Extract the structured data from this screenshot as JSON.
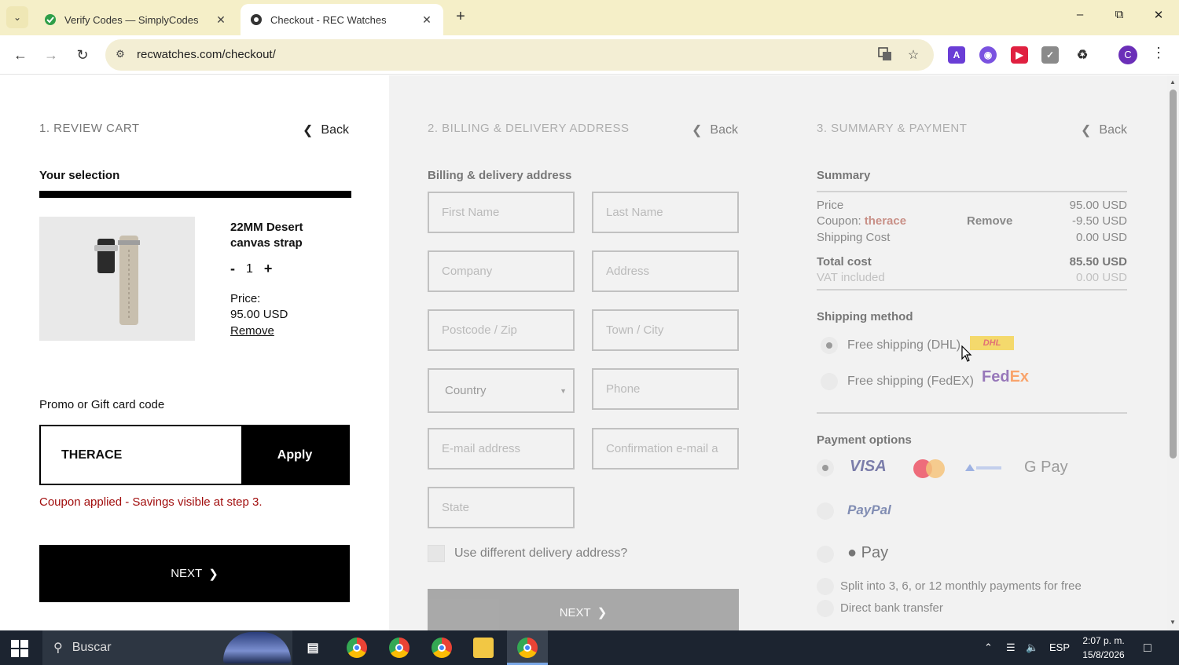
{
  "browser": {
    "tabs": [
      {
        "title": "Verify Codes — SimplyCodes",
        "active": false
      },
      {
        "title": "Checkout - REC Watches",
        "active": true
      }
    ],
    "url": "recwatches.com/checkout/",
    "profile_initial": "C"
  },
  "checkout": {
    "step1": {
      "title": "1. REVIEW CART",
      "back": "Back",
      "selection_heading": "Your selection",
      "product": {
        "name": "22MM Desert canvas strap",
        "qty_minus": "-",
        "qty": "1",
        "qty_plus": "+",
        "price_label": "Price:",
        "price": "95.00 USD",
        "remove": "Remove"
      },
      "promo_label": "Promo or Gift card code",
      "promo_value": "THERACE",
      "apply": "Apply",
      "promo_message": "Coupon applied - Savings visible at step 3.",
      "next": "NEXT"
    },
    "step2": {
      "title": "2. BILLING & DELIVERY ADDRESS",
      "back": "Back",
      "heading": "Billing & delivery address",
      "fields": {
        "first_name": "First Name",
        "last_name": "Last Name",
        "company": "Company",
        "address": "Address",
        "postcode": "Postcode / Zip",
        "town": "Town / City",
        "country": "Country",
        "phone": "Phone",
        "email": "E-mail address",
        "email_confirm": "Confirmation e-mail a",
        "state": "State"
      },
      "different_address": "Use different delivery address?",
      "next": "NEXT"
    },
    "step3": {
      "title": "3. SUMMARY & PAYMENT",
      "back": "Back",
      "summary_heading": "Summary",
      "price_label": "Price",
      "price_value": "95.00 USD",
      "coupon_label": "Coupon:",
      "coupon_code": "therace",
      "coupon_remove": "Remove",
      "coupon_value": "-9.50 USD",
      "shipping_label": "Shipping Cost",
      "shipping_value": "0.00 USD",
      "total_label": "Total cost",
      "total_value": "85.50 USD",
      "vat_label": "VAT included",
      "vat_value": "0.00 USD",
      "shipping_heading": "Shipping method",
      "shipping_dhl": "Free shipping (DHL)",
      "shipping_fedex": "Free shipping (FedEX)",
      "dhl_logo": "DHL",
      "fedex_logo_fed": "Fed",
      "fedex_logo_ex": "Ex",
      "payment_heading": "Payment options",
      "visa": "VISA",
      "gpay": "G Pay",
      "paypal": "PayPal",
      "applepay": "Pay",
      "split": "Split into 3, 6, or 12 monthly payments for free",
      "bank": "Direct bank transfer"
    }
  },
  "taskbar": {
    "search": "Buscar",
    "language": "ESP",
    "time": "2:07 p. m.",
    "date": "15/8/2026"
  },
  "colors": {
    "accent_dark": "#000000",
    "coupon_red": "#a73f2f",
    "promo_message_red": "#a10d0d",
    "column_bg": "#f2f2f2"
  },
  "icons": [
    "tab-list-icon",
    "verify-favicon",
    "rec-favicon",
    "close-icon",
    "plus-icon",
    "minimize-icon",
    "restore-icon",
    "back-icon",
    "forward-icon",
    "reload-icon",
    "site-info-icon",
    "translate-icon",
    "star-icon",
    "extension-icon",
    "kebab-menu-icon",
    "chevron-left-icon",
    "chevron-right-icon",
    "windows-start-icon",
    "search-icon",
    "task-view-icon",
    "chrome-icon",
    "file-explorer-icon",
    "wifi-icon",
    "volume-icon",
    "notification-icon"
  ]
}
